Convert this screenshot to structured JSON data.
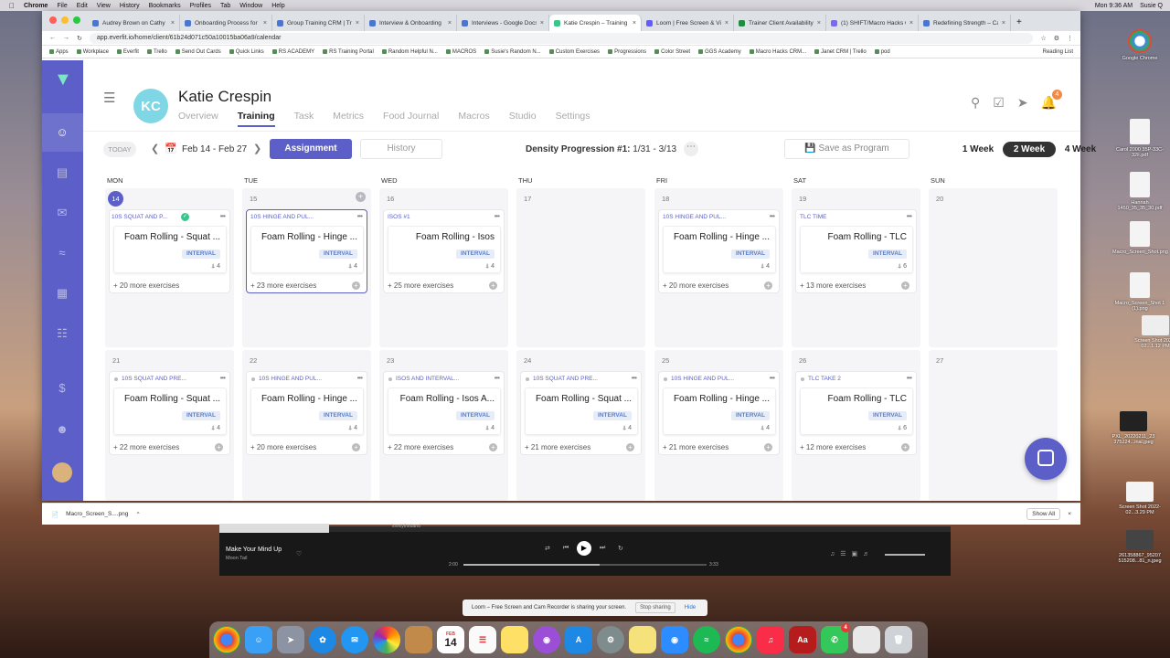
{
  "menubar": {
    "app": "Chrome",
    "items": [
      "File",
      "Edit",
      "View",
      "History",
      "Bookmarks",
      "Profiles",
      "Tab",
      "Window",
      "Help"
    ],
    "clock": "Mon 9:36 AM",
    "user": "Susie Q"
  },
  "browser": {
    "tabs": [
      {
        "label": "Audrey Brown on Cathy"
      },
      {
        "label": "Onboarding Process for"
      },
      {
        "label": "Group Training CRM | Tr"
      },
      {
        "label": "Interview & Onboarding"
      },
      {
        "label": "Interviews - Google Docs"
      },
      {
        "label": "Katie Crespin – Training"
      },
      {
        "label": "Loom | Free Screen & Vi"
      },
      {
        "label": "Trainer Client Availability"
      },
      {
        "label": "(1) SHIFT/Macro Hacks C"
      },
      {
        "label": "Redefining Strength – Ca"
      }
    ],
    "url": "app.everfit.io/home/client/61b24d071c50a10015ba06a9/calendar",
    "bookmarks": [
      "Apps",
      "Workplace",
      "Everfit",
      "Trello",
      "Send Out Cards",
      "Quick Links",
      "RS ACADEMY",
      "RS Training Portal",
      "Random Helpful N...",
      "MACROS",
      "Susie's Random N...",
      "Custom Exercises",
      "Progressions",
      "Color Street",
      "GGS Academy",
      "Macro Hacks CRM...",
      "Janet CRM | Trello",
      "pod"
    ],
    "reading_list": "Reading List"
  },
  "client": {
    "initials": "KC",
    "name": "Katie Crespin",
    "tabs": [
      "Overview",
      "Training",
      "Task",
      "Metrics",
      "Food Journal",
      "Macros",
      "Studio",
      "Settings"
    ],
    "active_tab": "Training",
    "notification_count": "4"
  },
  "toolbar": {
    "today": "TODAY",
    "date_range": "Feb 14 - Feb 27",
    "assignment": "Assignment",
    "history": "History",
    "program_name": "Density Progression #1:",
    "program_dates": "1/31 - 3/13",
    "save_program": "Save as Program",
    "weeks": [
      "1 Week",
      "2 Week",
      "4 Week"
    ],
    "active_week": "2 Week"
  },
  "calendar": {
    "days": [
      "MON",
      "TUE",
      "WED",
      "THU",
      "FRI",
      "SAT",
      "SUN"
    ],
    "week1": [
      {
        "num": "14",
        "title": "10S SQUAT AND P...",
        "exercise": "Foam Rolling - Squat ...",
        "tag": "INTERVAL",
        "sets": "4",
        "more": "+ 20 more exercises"
      },
      {
        "num": "15",
        "title": "10S HINGE AND PUL...",
        "exercise": "Foam Rolling - Hinge ...",
        "tag": "INTERVAL",
        "sets": "4",
        "more": "+ 23 more exercises"
      },
      {
        "num": "16",
        "title": "ISOS #1",
        "exercise": "Foam Rolling - Isos",
        "tag": "INTERVAL",
        "sets": "4",
        "more": "+ 25 more exercises"
      },
      {
        "num": "17"
      },
      {
        "num": "18",
        "title": "10S HINGE AND PUL...",
        "exercise": "Foam Rolling - Hinge ...",
        "tag": "INTERVAL",
        "sets": "4",
        "more": "+ 20 more exercises"
      },
      {
        "num": "19",
        "title": "TLC TIME",
        "exercise": "Foam Rolling - TLC",
        "tag": "INTERVAL",
        "sets": "6",
        "more": "+ 13 more exercises"
      },
      {
        "num": "20"
      }
    ],
    "week2": [
      {
        "num": "21",
        "title": "10S SQUAT AND PRE...",
        "exercise": "Foam Rolling - Squat ...",
        "tag": "INTERVAL",
        "sets": "4",
        "more": "+ 22 more exercises"
      },
      {
        "num": "22",
        "title": "10S HINGE AND PUL...",
        "exercise": "Foam Rolling - Hinge ...",
        "tag": "INTERVAL",
        "sets": "4",
        "more": "+ 20 more exercises"
      },
      {
        "num": "23",
        "title": "ISOS AND INTERVAL...",
        "exercise": "Foam Rolling - Isos A...",
        "tag": "INTERVAL",
        "sets": "4",
        "more": "+ 22 more exercises"
      },
      {
        "num": "24",
        "title": "10S SQUAT AND PRE...",
        "exercise": "Foam Rolling - Squat ...",
        "tag": "INTERVAL",
        "sets": "4",
        "more": "+ 21 more exercises"
      },
      {
        "num": "25",
        "title": "10S HINGE AND PUL...",
        "exercise": "Foam Rolling - Hinge ...",
        "tag": "INTERVAL",
        "sets": "4",
        "more": "+ 21 more exercises"
      },
      {
        "num": "26",
        "title": "TLC TAKE 2",
        "exercise": "Foam Rolling - TLC",
        "tag": "INTERVAL",
        "sets": "6",
        "more": "+ 12 more exercises"
      },
      {
        "num": "27"
      }
    ]
  },
  "downloads": {
    "file": "Macro_Screen_S....png",
    "show_all": "Show All"
  },
  "spotify": {
    "title": "Make Your Mind Up",
    "artist": "Moon Tail",
    "elapsed": "2:00",
    "duration": "3:33",
    "progress": 0.56,
    "band": "lovelytheband"
  },
  "loom": {
    "message": "Loom – Free Screen and Cam Recorder is sharing your screen.",
    "stop": "Stop sharing",
    "hide": "Hide"
  },
  "desktop": [
    {
      "label": "Google Chrome"
    },
    {
      "label": "Carol 2000 35P-33C-32F.pdf"
    },
    {
      "label": "Hannah 1450_35_35_30.pdf"
    },
    {
      "label": "Macro_Screen_Shot.png"
    },
    {
      "label": "Macro_Screen_Shot 1 (1).png"
    },
    {
      "label": "Screen Shot 2022-02...1.12 PM"
    },
    {
      "label": "PXL_20220211_23 375224...inal.jpeg"
    },
    {
      "label": "Screen Shot 2022-02...3.29 PM"
    },
    {
      "label": "261358867_95207 515208...81_n.jpeg"
    }
  ],
  "dock_calendar": {
    "month": "FEB",
    "day": "14"
  },
  "colors": {
    "accent": "#5b5fc7",
    "interval_bg": "#e6ecf8",
    "done": "#3cc58b"
  }
}
